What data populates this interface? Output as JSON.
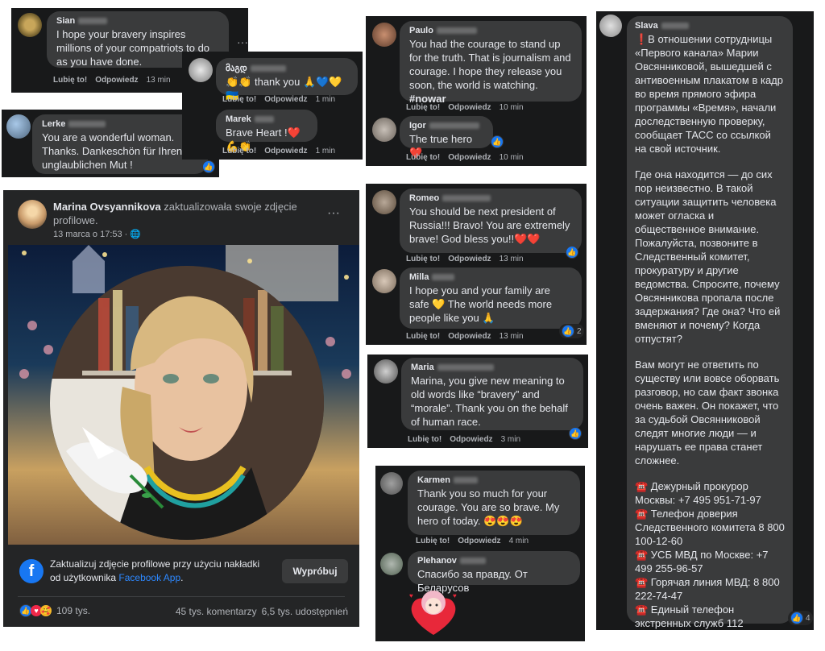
{
  "comments": {
    "sian": {
      "name": "Sian",
      "text": "I hope your bravery inspires millions of your compatriots to do as you have done.",
      "like": "Lubię to!",
      "reply": "Odpowiedz",
      "time": "13 min"
    },
    "geo": {
      "name": "მაგდ",
      "text": "👏👏 thank you 🙏💙💛🇺🇦",
      "like": "Lubię to!",
      "reply": "Odpowiedz",
      "time": "1 min"
    },
    "marek": {
      "name": "Marek",
      "text": "Brave Heart !❤️💪👏",
      "like": "Lubię to!",
      "reply": "Odpowiedz",
      "time": "1 min"
    },
    "lerke": {
      "name": "Lerke",
      "text": "You are a wonderful woman. Thanks. Dankeschön für Ihren unglaublichen Mut !"
    },
    "paulo": {
      "name": "Paulo",
      "text": "You had the courage to stand up for the truth. That is journalism and courage. I hope they release you soon, the world is watching.",
      "hashtag": "#nowar",
      "like": "Lubię to!",
      "reply": "Odpowiedz",
      "time": "10 min"
    },
    "igor": {
      "name": "Igor",
      "text": "The true hero ❤️",
      "like": "Lubię to!",
      "reply": "Odpowiedz",
      "time": "10 min"
    },
    "romeo": {
      "name": "Romeo",
      "text": "You should be next president of Russia!!! Bravo! You are extremely brave! God bless you!!❤️❤️",
      "like": "Lubię to!",
      "reply": "Odpowiedz",
      "time": "13 min"
    },
    "milla": {
      "name": "Milla",
      "text": "I hope you and your family are safe 💛 The world needs more people like you 🙏",
      "like": "Lubię to!",
      "reply": "Odpowiedz",
      "time": "13 min",
      "reactions": "2"
    },
    "maria": {
      "name": "Maria",
      "text": "Marina, you give new meaning to old words like “bravery” and “morale”. Thank you on the behalf of human race.",
      "like": "Lubię to!",
      "reply": "Odpowiedz",
      "time": "3 min"
    },
    "karmen": {
      "name": "Karmen",
      "text": "Thank you so much for your courage. You are so brave. My hero of today. 😍😍😍",
      "like": "Lubię to!",
      "reply": "Odpowiedz",
      "time": "4 min"
    },
    "plehanov": {
      "name": "Plehanov",
      "text": "Спасибо за правду. От Беларусов"
    },
    "slava": {
      "name": "Slava",
      "p1": "❗В отношении сотрудницы «Первого канала» Марии Овсянниковой, вышедшей с антивоенным плакатом в кадр во время прямого эфира программы «Время», начали доследственную проверку, сообщает ТАСС со ссылкой на свой источник.",
      "p2": "Где она находится — до сих пор неизвестно. В такой ситуации защитить человека может огласка и общественное внимание. Пожалуйста, позвоните в Следственный комитет, прокуратуру и другие ведомства. Спросите, почему Овсянникова пропала после задержания? Где она? Что ей вменяют и почему? Когда отпустят?",
      "p3": "Вам могут не ответить по существу или вовсе оборвать разговор, но сам факт звонка очень важен. Он покажет, что за судьбой Овсянниковой следят многие люди — и нарушать ее права станет сложнее.",
      "p4": "☎️ Дежурный прокурор Москвы: +7 495 951-71-97\n☎️ Телефон доверия Следственного комитета 8 800 100-12-60\n☎️ УСБ МВД по Москве: +7 499 255-96-57\n☎️ Горячая линия МВД: 8 800 222-74-47\n☎️ Единый телефон экстренных служб 112",
      "reactions": "4"
    }
  },
  "post": {
    "author": "Marina Ovsyannikova",
    "action": "zaktualizowała swoje zdjęcie profilowe.",
    "date": "13 marca o 17:53 ·",
    "promo_text": "Zaktualizuj zdjęcie profilowe przy użyciu nakładki od użytkownika",
    "promo_link": "Facebook App",
    "promo_dot": ".",
    "try_button": "Wypróbuj",
    "reactions_count": "109 tys.",
    "comments_count": "45 tys. komentarzy",
    "shares_count": "6,5 tys. udostępnień"
  },
  "colors": {
    "panel": "#18191a",
    "bubble": "#3a3b3c",
    "link": "#2d88ff",
    "like": "#1877f2",
    "heart": "#f02849"
  }
}
